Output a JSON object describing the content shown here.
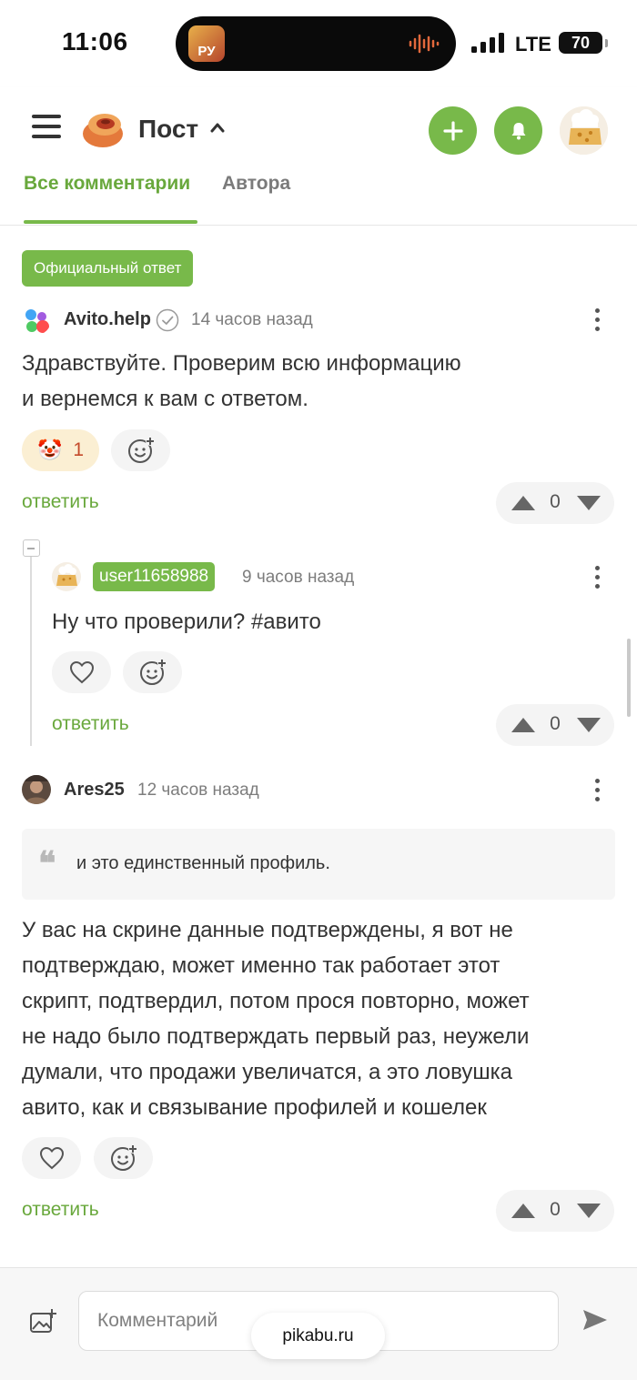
{
  "status_bar": {
    "time": "11:06",
    "network": "LTE",
    "battery": "70",
    "live_app_label": "РУ"
  },
  "header": {
    "title": "Пост",
    "icons": [
      "menu-icon",
      "pikabu-logo",
      "plus-icon",
      "bell-icon",
      "avatar"
    ]
  },
  "tabs": [
    {
      "label": "Все комментарии",
      "active": true
    },
    {
      "label": "Автора",
      "active": false
    }
  ],
  "comments": [
    {
      "badge": "Официальный ответ",
      "author": "Avito.help",
      "verified": true,
      "time": "14 часов назад",
      "text_lines": [
        "Здравствуйте. Проверим всю информацию",
        "и вернемся к вам с ответом."
      ],
      "reaction": {
        "emoji": "🤡",
        "count": "1"
      },
      "reply_label": "ответить",
      "rating": "0"
    },
    {
      "author": "user11658988",
      "time": "9 часов назад",
      "text": "Ну что проверили? #авито",
      "reply_label": "ответить",
      "rating": "0"
    },
    {
      "author": "Ares25",
      "time": "12 часов назад",
      "quote": "и это единственный профиль.",
      "text_lines": [
        "У вас на скрине данные подтверждены, я вот не",
        "подтверждаю, может именно так работает этот",
        "скрипт, подтвердил, потом прося повторно, может",
        "не надо было подтверждать первый раз, неужели",
        "думали, что продажи увеличатся, а это ловушка",
        "авито, как и связывание профилей и кошелек"
      ],
      "reply_label": "ответить",
      "rating": "0"
    }
  ],
  "composer": {
    "placeholder": "Комментарий"
  },
  "browser": {
    "url": "pikabu.ru"
  },
  "colors": {
    "accent": "#78b94a",
    "accent_text": "#69a83c",
    "reaction_bg": "#fbefd3"
  }
}
